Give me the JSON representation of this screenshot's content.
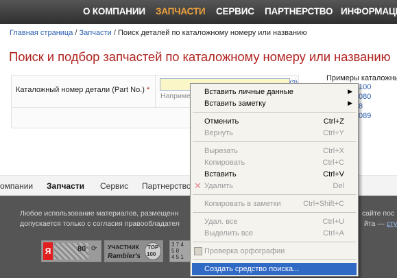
{
  "topnav": {
    "items": [
      "О КОМПАНИИ",
      "ЗАПЧАСТИ",
      "СЕРВИС",
      "ПАРТНЕРСТВО",
      "ИНФОРМАЦИ"
    ]
  },
  "breadcrumb": {
    "home": "Главная страница",
    "parts": "Запчасти",
    "current": "Поиск деталей по каталожному номеру или названию",
    "sep": "/"
  },
  "page_title": "Поиск и подбор запчастей по каталожному номеру или названию",
  "form": {
    "label": "Каталожный номер детали (Part No.)",
    "required_mark": "*",
    "input_value": "",
    "hint": "Наприме",
    "help_link": "(?)"
  },
  "examples": {
    "title": "Примеры каталожных",
    "items": [
      "100",
      "080",
      "8",
      "089"
    ]
  },
  "bottomnav": {
    "items": [
      "омпании",
      "Запчасти",
      "Сервис",
      "Партнерство"
    ]
  },
  "footer": {
    "line1": "Любое использование материалов, размещенн",
    "line2": "допускается только с согласия правообладател",
    "right1": "сайте пос",
    "right2_prefix": "йта —",
    "right2_link": "сту",
    "counter1_value": "80",
    "counter1_icon": "Я",
    "rambler_line1": "УЧАСТНИК",
    "rambler_line2": "Rambler's",
    "rambler_top": "TOP",
    "rambler_top_num": "100",
    "counter3_lines": [
      "3 7 4",
      "5 8",
      "4 5 1"
    ]
  },
  "context_menu": {
    "items": [
      {
        "label": "Вставить личные данные",
        "shortcut": "",
        "submenu": true,
        "disabled": false
      },
      {
        "label": "Вставить заметку",
        "shortcut": "",
        "submenu": true,
        "disabled": false
      },
      {
        "label": "Отменить",
        "shortcut": "Ctrl+Z",
        "submenu": false,
        "disabled": false
      },
      {
        "label": "Вернуть",
        "shortcut": "Ctrl+Y",
        "submenu": false,
        "disabled": true
      },
      {
        "label": "Вырезать",
        "shortcut": "Ctrl+X",
        "submenu": false,
        "disabled": true
      },
      {
        "label": "Копировать",
        "shortcut": "Ctrl+C",
        "submenu": false,
        "disabled": true
      },
      {
        "label": "Вставить",
        "shortcut": "Ctrl+V",
        "submenu": false,
        "disabled": false
      },
      {
        "label": "Удалить",
        "shortcut": "Del",
        "submenu": false,
        "disabled": true
      },
      {
        "label": "Копировать в заметки",
        "shortcut": "Ctrl+Shift+C",
        "submenu": false,
        "disabled": true
      },
      {
        "label": "Удал. все",
        "shortcut": "Ctrl+U",
        "submenu": false,
        "disabled": true
      },
      {
        "label": "Выделить все",
        "shortcut": "Ctrl+A",
        "submenu": false,
        "disabled": true
      },
      {
        "label": "Проверка орфографии",
        "shortcut": "",
        "submenu": false,
        "disabled": true
      },
      {
        "label": "Создать средство поиска...",
        "shortcut": "",
        "submenu": false,
        "disabled": false,
        "highlighted": true
      }
    ]
  },
  "colors": {
    "accent_red": "#b0231f",
    "nav_active": "#f0a23c",
    "link_blue": "#2a5db0",
    "menu_highlight": "#316ac5"
  }
}
